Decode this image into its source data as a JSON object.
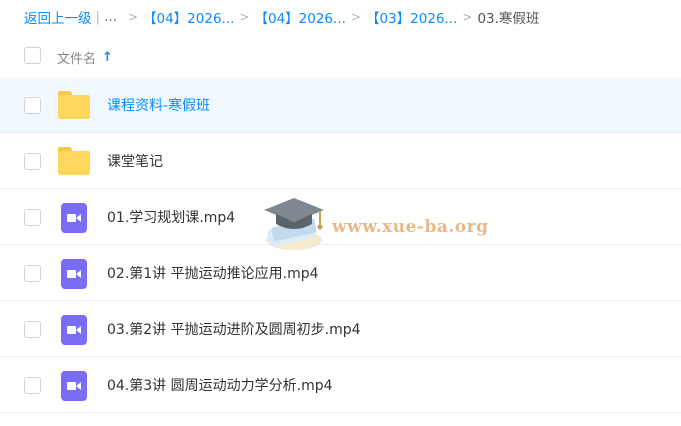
{
  "breadcrumb": {
    "back_label": "返回上一级",
    "divider": "|",
    "ellipsis": "...",
    "crumbs": [
      "【04】2026...",
      "【04】2026...",
      "【03】2026..."
    ],
    "separator": ">",
    "current": "03.寒假班"
  },
  "header": {
    "column_label": "文件名",
    "sort_indicator": "↑"
  },
  "files": [
    {
      "type": "folder",
      "name": "课程资料-寒假班",
      "selected": true
    },
    {
      "type": "folder",
      "name": "课堂笔记",
      "selected": false
    },
    {
      "type": "video",
      "name": "01.学习规划课.mp4",
      "selected": false
    },
    {
      "type": "video",
      "name": "02.第1讲 平抛运动推论应用.mp4",
      "selected": false
    },
    {
      "type": "video",
      "name": "03.第2讲 平抛运动进阶及圆周初步.mp4",
      "selected": false
    },
    {
      "type": "video",
      "name": "04.第3讲 圆周运动动力学分析.mp4",
      "selected": false
    }
  ],
  "watermark": {
    "text": "www.xue-ba.org"
  },
  "colors": {
    "link": "#0a8cff",
    "folder": "#ffd65c",
    "video": "#7b6cf6",
    "selected_row": "#f2f8ff"
  }
}
